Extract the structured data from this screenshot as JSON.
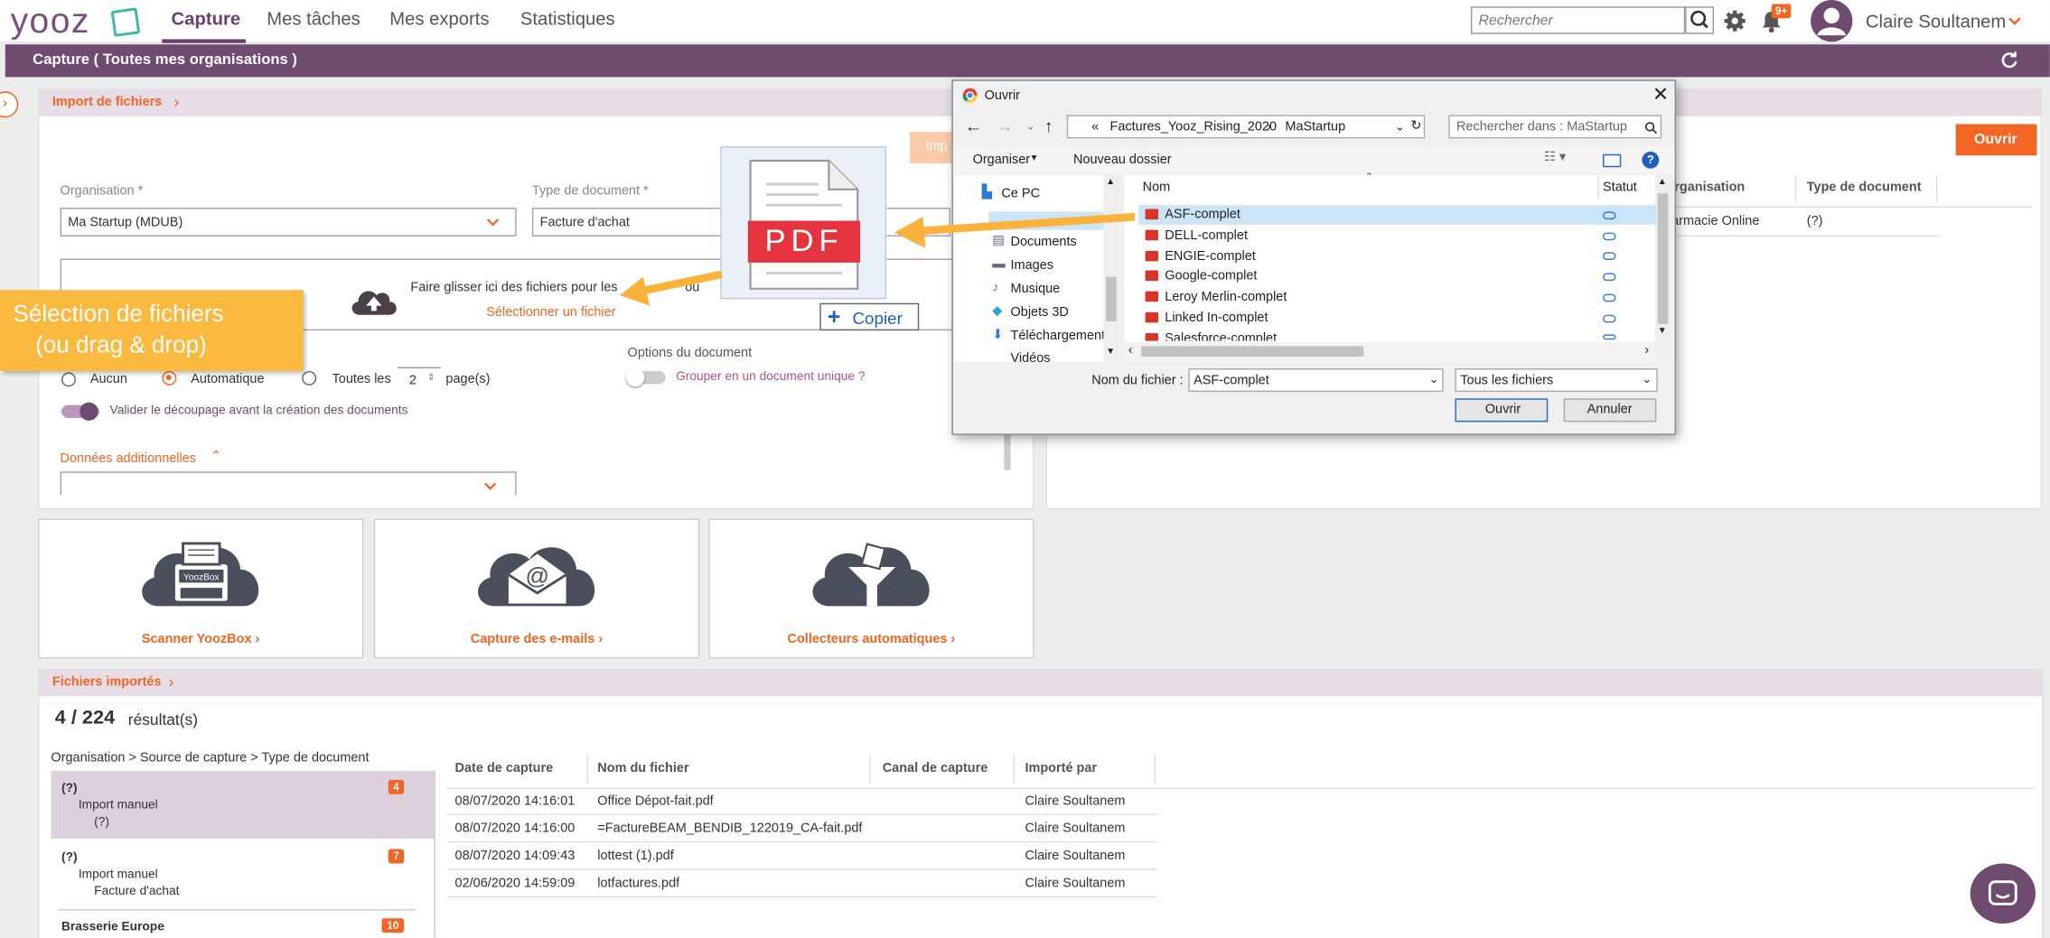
{
  "app": {
    "logo": "yooz",
    "nav": [
      "Capture",
      "Mes tâches",
      "Mes exports",
      "Statistiques"
    ],
    "search_placeholder": "Rechercher",
    "notif_count": "9+",
    "user": "Claire Soultanem"
  },
  "header": {
    "title": "Capture ( Toutes mes organisations )"
  },
  "import": {
    "section": "Import de fichiers",
    "org_label": "Organisation *",
    "org_value": "Ma Startup (MDUB)",
    "type_label": "Type de document *",
    "type_value": "Facture d'achat",
    "drop_text": "Faire glisser ici des fichiers pour les",
    "drop_text2": "ou",
    "select_link": "Sélectionner un fichier",
    "split_none": "Aucun",
    "split_auto": "Automatique",
    "split_every": "Toutes les",
    "split_n": "2",
    "split_unit": "page(s)",
    "options_label": "Options du document",
    "group_label": "Grouper en un document unique ?",
    "validate_label": "Valider le découpage avant la création des documents",
    "additional": "Données additionnelles",
    "imp_btn": "Imp"
  },
  "right_panel": {
    "open_btn": "Ouvrir",
    "col_org": "Organisation",
    "col_type": "Type de document",
    "row_org": "harmacie Online",
    "row_type": "(?)"
  },
  "cards": [
    {
      "label": "Scanner YoozBox"
    },
    {
      "label": "Capture des e-mails"
    },
    {
      "label": "Collecteurs automatiques"
    }
  ],
  "imported": {
    "section": "Fichiers importés",
    "count": "4 / 224",
    "count_suffix": "résultat(s)",
    "tree_header": "Organisation > Source de capture > Type de document",
    "groups": [
      {
        "title": "(?)",
        "sub": "Import manuel",
        "sub2": "(?)",
        "badge": "4"
      },
      {
        "title": "(?)",
        "sub": "Import manuel",
        "sub2": "Facture d'achat",
        "badge": "7"
      },
      {
        "title": "Brasserie Europe",
        "badge": "10"
      }
    ],
    "columns": [
      "Date de capture",
      "Nom du fichier",
      "Canal de capture",
      "Importé par"
    ],
    "rows": [
      [
        "08/07/2020 14:16:01",
        "Office Dépot-fait.pdf",
        "",
        "Claire Soultanem"
      ],
      [
        "08/07/2020 14:16:00",
        "=FactureBEAM_BENDIB_122019_CA-fait.pdf",
        "",
        "Claire Soultanem"
      ],
      [
        "08/07/2020 14:09:43",
        "lottest (1).pdf",
        "",
        "Claire Soultanem"
      ],
      [
        "02/06/2020 14:59:09",
        "lotfactures.pdf",
        "",
        "Claire Soultanem"
      ]
    ]
  },
  "dialog": {
    "title": "Ouvrir",
    "path_prefix": "«",
    "path1": "Factures_Yooz_Rising_2020",
    "path2": "MaStartup",
    "search": "Rechercher dans : MaStartup",
    "organize": "Organiser",
    "new_folder": "Nouveau dossier",
    "col_name": "Nom",
    "col_status": "Statut",
    "nav": [
      "Ce PC",
      "Documents",
      "Images",
      "Musique",
      "Objets 3D",
      "Téléchargements",
      "Vidéos"
    ],
    "files": [
      "ASF-complet",
      "DELL-complet",
      "ENGIE-complet",
      "Google-complet",
      "Leroy Merlin-complet",
      "Linked In-complet",
      "Salesforce-complet"
    ],
    "filename_label": "Nom du fichier :",
    "filename_value": "ASF-complet",
    "filter": "Tous les fichiers",
    "open": "Ouvrir",
    "cancel": "Annuler"
  },
  "overlay": {
    "pdf": "PDF",
    "copy": "Copier",
    "callout_l1": "Sélection de fichiers",
    "callout_l2": "(ou drag & drop)"
  },
  "colors": {
    "purple": "#6e4b6f",
    "orange": "#f26522",
    "callout": "#fbb93f"
  }
}
